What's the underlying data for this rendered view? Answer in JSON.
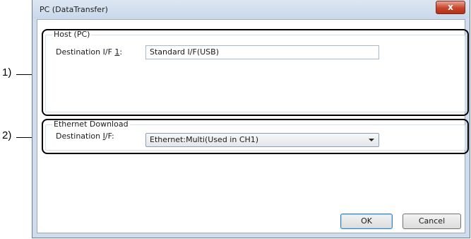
{
  "window": {
    "title": "PC (DataTransfer)",
    "close_glyph": "x"
  },
  "callouts": [
    "1)",
    "2)"
  ],
  "host_group": {
    "title": "Host (PC)",
    "dest_label_prefix": "Destination I/F ",
    "dest_label_key": "1",
    "dest_label_suffix": ":",
    "dest_value": "Standard I/F(USB)"
  },
  "ethernet_group": {
    "title": "Ethernet Download",
    "dest_label_prefix": "Destination ",
    "dest_label_key": "I",
    "dest_label_suffix": "/F:",
    "dest_value": "Ethernet:Multi(Used in CH1)"
  },
  "buttons": {
    "ok": "OK",
    "cancel": "Cancel"
  }
}
